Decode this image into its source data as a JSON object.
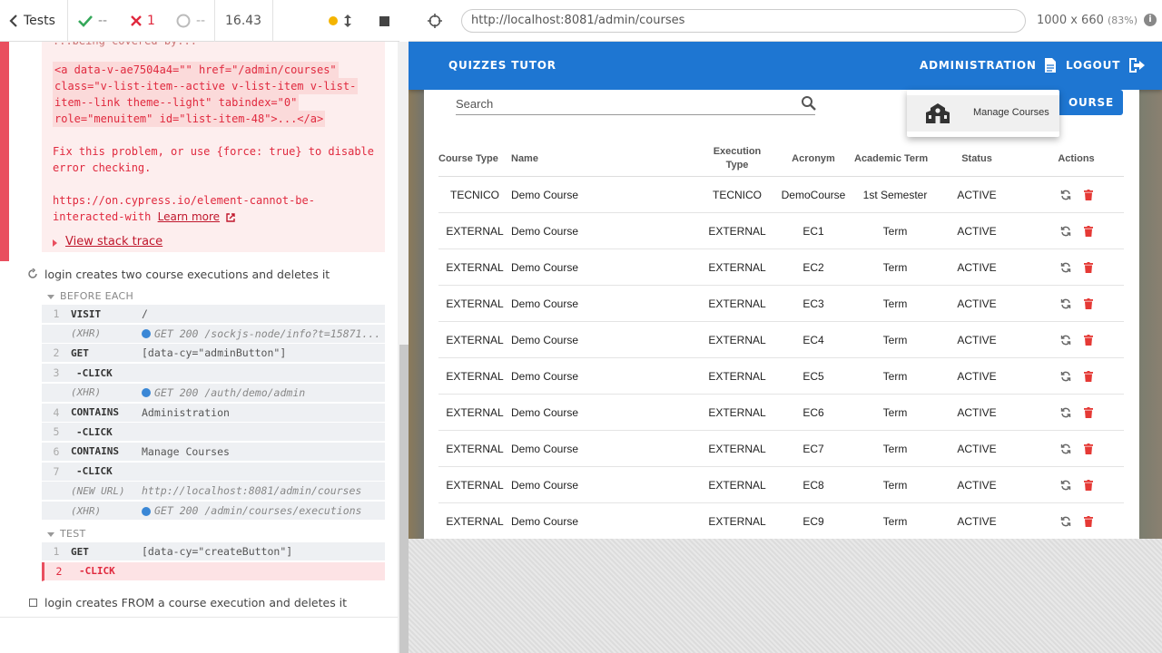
{
  "reporter": {
    "tests_label": "Tests",
    "passed": "--",
    "failed": "1",
    "pending": "--",
    "duration": "16.43"
  },
  "error": {
    "cut_line": "...being covered by...",
    "anchor_lines": [
      "<a data-v-ae7504a4=\"\" href=\"/admin/courses\"",
      "class=\"v-list-item--active v-list-item v-list-",
      "item--link theme--light\" tabindex=\"0\"",
      "role=\"menuitem\" id=\"list-item-48\">...</a>"
    ],
    "fix_lines": [
      "Fix this problem, or use {force: true} to disable",
      "error checking."
    ],
    "url_lines": [
      "https://on.cypress.io/element-cannot-be-",
      "interacted-with"
    ],
    "learn_more": "Learn more",
    "stack_trace": "View stack trace"
  },
  "test1": {
    "title": "login creates two course executions and deletes it",
    "before_each": "BEFORE EACH",
    "test_label": "TEST"
  },
  "commands": [
    {
      "num": "1",
      "name": "VISIT",
      "msg": "/"
    },
    {
      "num": "",
      "name": "(XHR)",
      "msg": "GET 200 /sockjs-node/info?t=15871..."
    },
    {
      "num": "2",
      "name": "GET",
      "msg": "[data-cy=\"adminButton\"]"
    },
    {
      "num": "3",
      "name": "-CLICK",
      "msg": ""
    },
    {
      "num": "",
      "name": "(XHR)",
      "msg": "GET 200 /auth/demo/admin"
    },
    {
      "num": "4",
      "name": "CONTAINS",
      "msg": "Administration"
    },
    {
      "num": "5",
      "name": "-CLICK",
      "msg": ""
    },
    {
      "num": "6",
      "name": "CONTAINS",
      "msg": "Manage Courses"
    },
    {
      "num": "7",
      "name": "-CLICK",
      "msg": ""
    },
    {
      "num": "",
      "name": "(NEW URL)",
      "msg": "http://localhost:8081/admin/courses"
    },
    {
      "num": "",
      "name": "(XHR)",
      "msg": "GET 200 /admin/courses/executions"
    }
  ],
  "test_commands": [
    {
      "num": "1",
      "name": "GET",
      "msg": "[data-cy=\"createButton\"]"
    },
    {
      "num": "2",
      "name": "-CLICK",
      "msg": ""
    }
  ],
  "test2": {
    "title": "login creates FROM a course execution and deletes it"
  },
  "browser": {
    "url": "http://localhost:8081/admin/courses",
    "viewport": "1000 x 660",
    "scale": "(83%)"
  },
  "app": {
    "title": "QUIZZES TUTOR",
    "admin_label": "ADMINISTRATION",
    "logout_label": "LOGOUT",
    "search_placeholder": "Search",
    "create_button": "OURSE",
    "menu_item": "Manage Courses",
    "accent": "#1e76d2",
    "delete_color": "#e53935"
  },
  "table": {
    "headers": [
      "Course Type",
      "Name",
      "Execution Type",
      "Acronym",
      "Academic Term",
      "Status",
      "Actions"
    ],
    "rows": [
      [
        "TECNICO",
        "Demo Course",
        "TECNICO",
        "DemoCourse",
        "1st Semester",
        "ACTIVE"
      ],
      [
        "EXTERNAL",
        "Demo Course",
        "EXTERNAL",
        "EC1",
        "Term",
        "ACTIVE"
      ],
      [
        "EXTERNAL",
        "Demo Course",
        "EXTERNAL",
        "EC2",
        "Term",
        "ACTIVE"
      ],
      [
        "EXTERNAL",
        "Demo Course",
        "EXTERNAL",
        "EC3",
        "Term",
        "ACTIVE"
      ],
      [
        "EXTERNAL",
        "Demo Course",
        "EXTERNAL",
        "EC4",
        "Term",
        "ACTIVE"
      ],
      [
        "EXTERNAL",
        "Demo Course",
        "EXTERNAL",
        "EC5",
        "Term",
        "ACTIVE"
      ],
      [
        "EXTERNAL",
        "Demo Course",
        "EXTERNAL",
        "EC6",
        "Term",
        "ACTIVE"
      ],
      [
        "EXTERNAL",
        "Demo Course",
        "EXTERNAL",
        "EC7",
        "Term",
        "ACTIVE"
      ],
      [
        "EXTERNAL",
        "Demo Course",
        "EXTERNAL",
        "EC8",
        "Term",
        "ACTIVE"
      ],
      [
        "EXTERNAL",
        "Demo Course",
        "EXTERNAL",
        "EC9",
        "Term",
        "ACTIVE"
      ]
    ]
  }
}
